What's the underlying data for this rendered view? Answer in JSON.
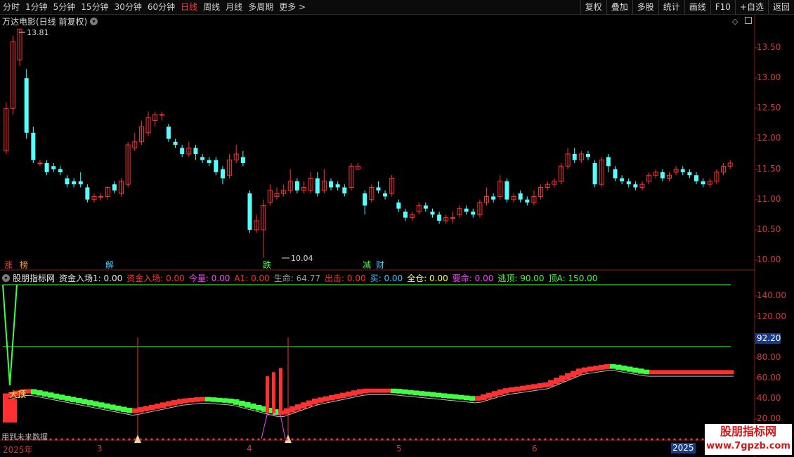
{
  "toolbar": {
    "periods": [
      "分时",
      "1分钟",
      "5分钟",
      "15分钟",
      "30分钟",
      "60分钟",
      "日线",
      "周线",
      "月线",
      "多周期",
      "更多 >"
    ],
    "active_period": "日线",
    "buttons": [
      "复权",
      "叠加",
      "多股",
      "统计",
      "画线",
      "F10",
      "+自选",
      "返回"
    ]
  },
  "main_chart": {
    "title": "万达电影(日线 前复权)",
    "high_label": "13.81",
    "low_label": "10.04",
    "price_ticks": [
      "13.50",
      "13.00",
      "12.50",
      "12.00",
      "11.50",
      "11.00",
      "10.50",
      "10.00"
    ],
    "event_tags": [
      {
        "text": "涨",
        "color": "#ff4040"
      },
      {
        "text": "榜",
        "color": "#ffa020"
      },
      {
        "text": "解",
        "color": "#40c8ff"
      },
      {
        "text": "跌",
        "color": "#40ff40"
      },
      {
        "text": "减",
        "color": "#40ff40"
      },
      {
        "text": "财",
        "color": "#40c8ff"
      }
    ]
  },
  "indicator": {
    "name": "股朋指标网",
    "fields": [
      {
        "label": "资金入场1: 0.00",
        "color": "#e6e6e6"
      },
      {
        "label": "资金入场: 0.00",
        "color": "#ff3030"
      },
      {
        "label": "今量: 0.00",
        "color": "#ff40ff"
      },
      {
        "label": "A1: 0.00",
        "color": "#ff3030"
      },
      {
        "label": "生命: 64.77",
        "color": "#a0a0a0"
      },
      {
        "label": "出击: 0.00",
        "color": "#ff3030"
      },
      {
        "label": "买: 0.00",
        "color": "#40c8ff"
      },
      {
        "label": "全仓: 0.00",
        "color": "#ffff40"
      },
      {
        "label": "要命: 0.00",
        "color": "#ff40ff"
      },
      {
        "label": "逃顶: 90.00",
        "color": "#40ff40"
      },
      {
        "label": "顶A: 150.00",
        "color": "#40ff40"
      }
    ],
    "ticks": [
      "140.00",
      "120.00",
      "80.00",
      "60.00",
      "40.00",
      "20.00"
    ],
    "current_value": "92.20",
    "top_label": "大顶",
    "future_note": "用到未来数据"
  },
  "time_axis": {
    "labels": [
      "2025年",
      "3",
      "4",
      "5",
      "6"
    ],
    "right_label": "2025"
  },
  "watermark": {
    "line1": "股朋指标网",
    "line2": "www.7gpzb.com"
  },
  "colors": {
    "up": "#ff3030",
    "down": "#54ffff",
    "green": "#40ff40"
  }
}
